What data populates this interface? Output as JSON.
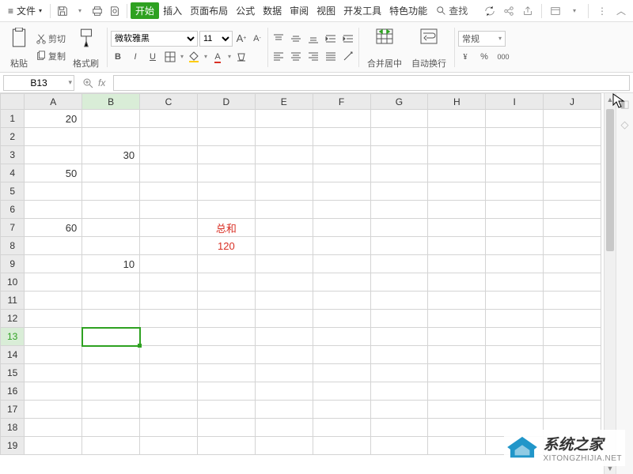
{
  "menu": {
    "file": "文件",
    "tabs": [
      "开始",
      "插入",
      "页面布局",
      "公式",
      "数据",
      "审阅",
      "视图",
      "开发工具",
      "特色功能"
    ],
    "active_tab": 0,
    "search": "查找"
  },
  "ribbon": {
    "paste": "粘贴",
    "cut": "剪切",
    "copy": "复制",
    "format_painter": "格式刷",
    "font_name": "微软雅黑",
    "font_size": "11",
    "merge": "合并居中",
    "wrap": "自动换行",
    "number_format": "常规",
    "currency": "¥",
    "percent": "%",
    "thousands": "000"
  },
  "formula": {
    "name_box": "B13",
    "fx_label": "fx",
    "input": ""
  },
  "sheet": {
    "cols": [
      "A",
      "B",
      "C",
      "D",
      "E",
      "F",
      "G",
      "H",
      "I",
      "J"
    ],
    "selected_col": 1,
    "selected_row": 13,
    "cells": {
      "A1": "20",
      "B3": "30",
      "A4": "50",
      "A7": "60",
      "D7": "总和",
      "D8": "120",
      "B9": "10"
    },
    "rows": 19
  },
  "watermark": {
    "title": "系统之家",
    "url": "XITONGZHIJIA.NET"
  }
}
